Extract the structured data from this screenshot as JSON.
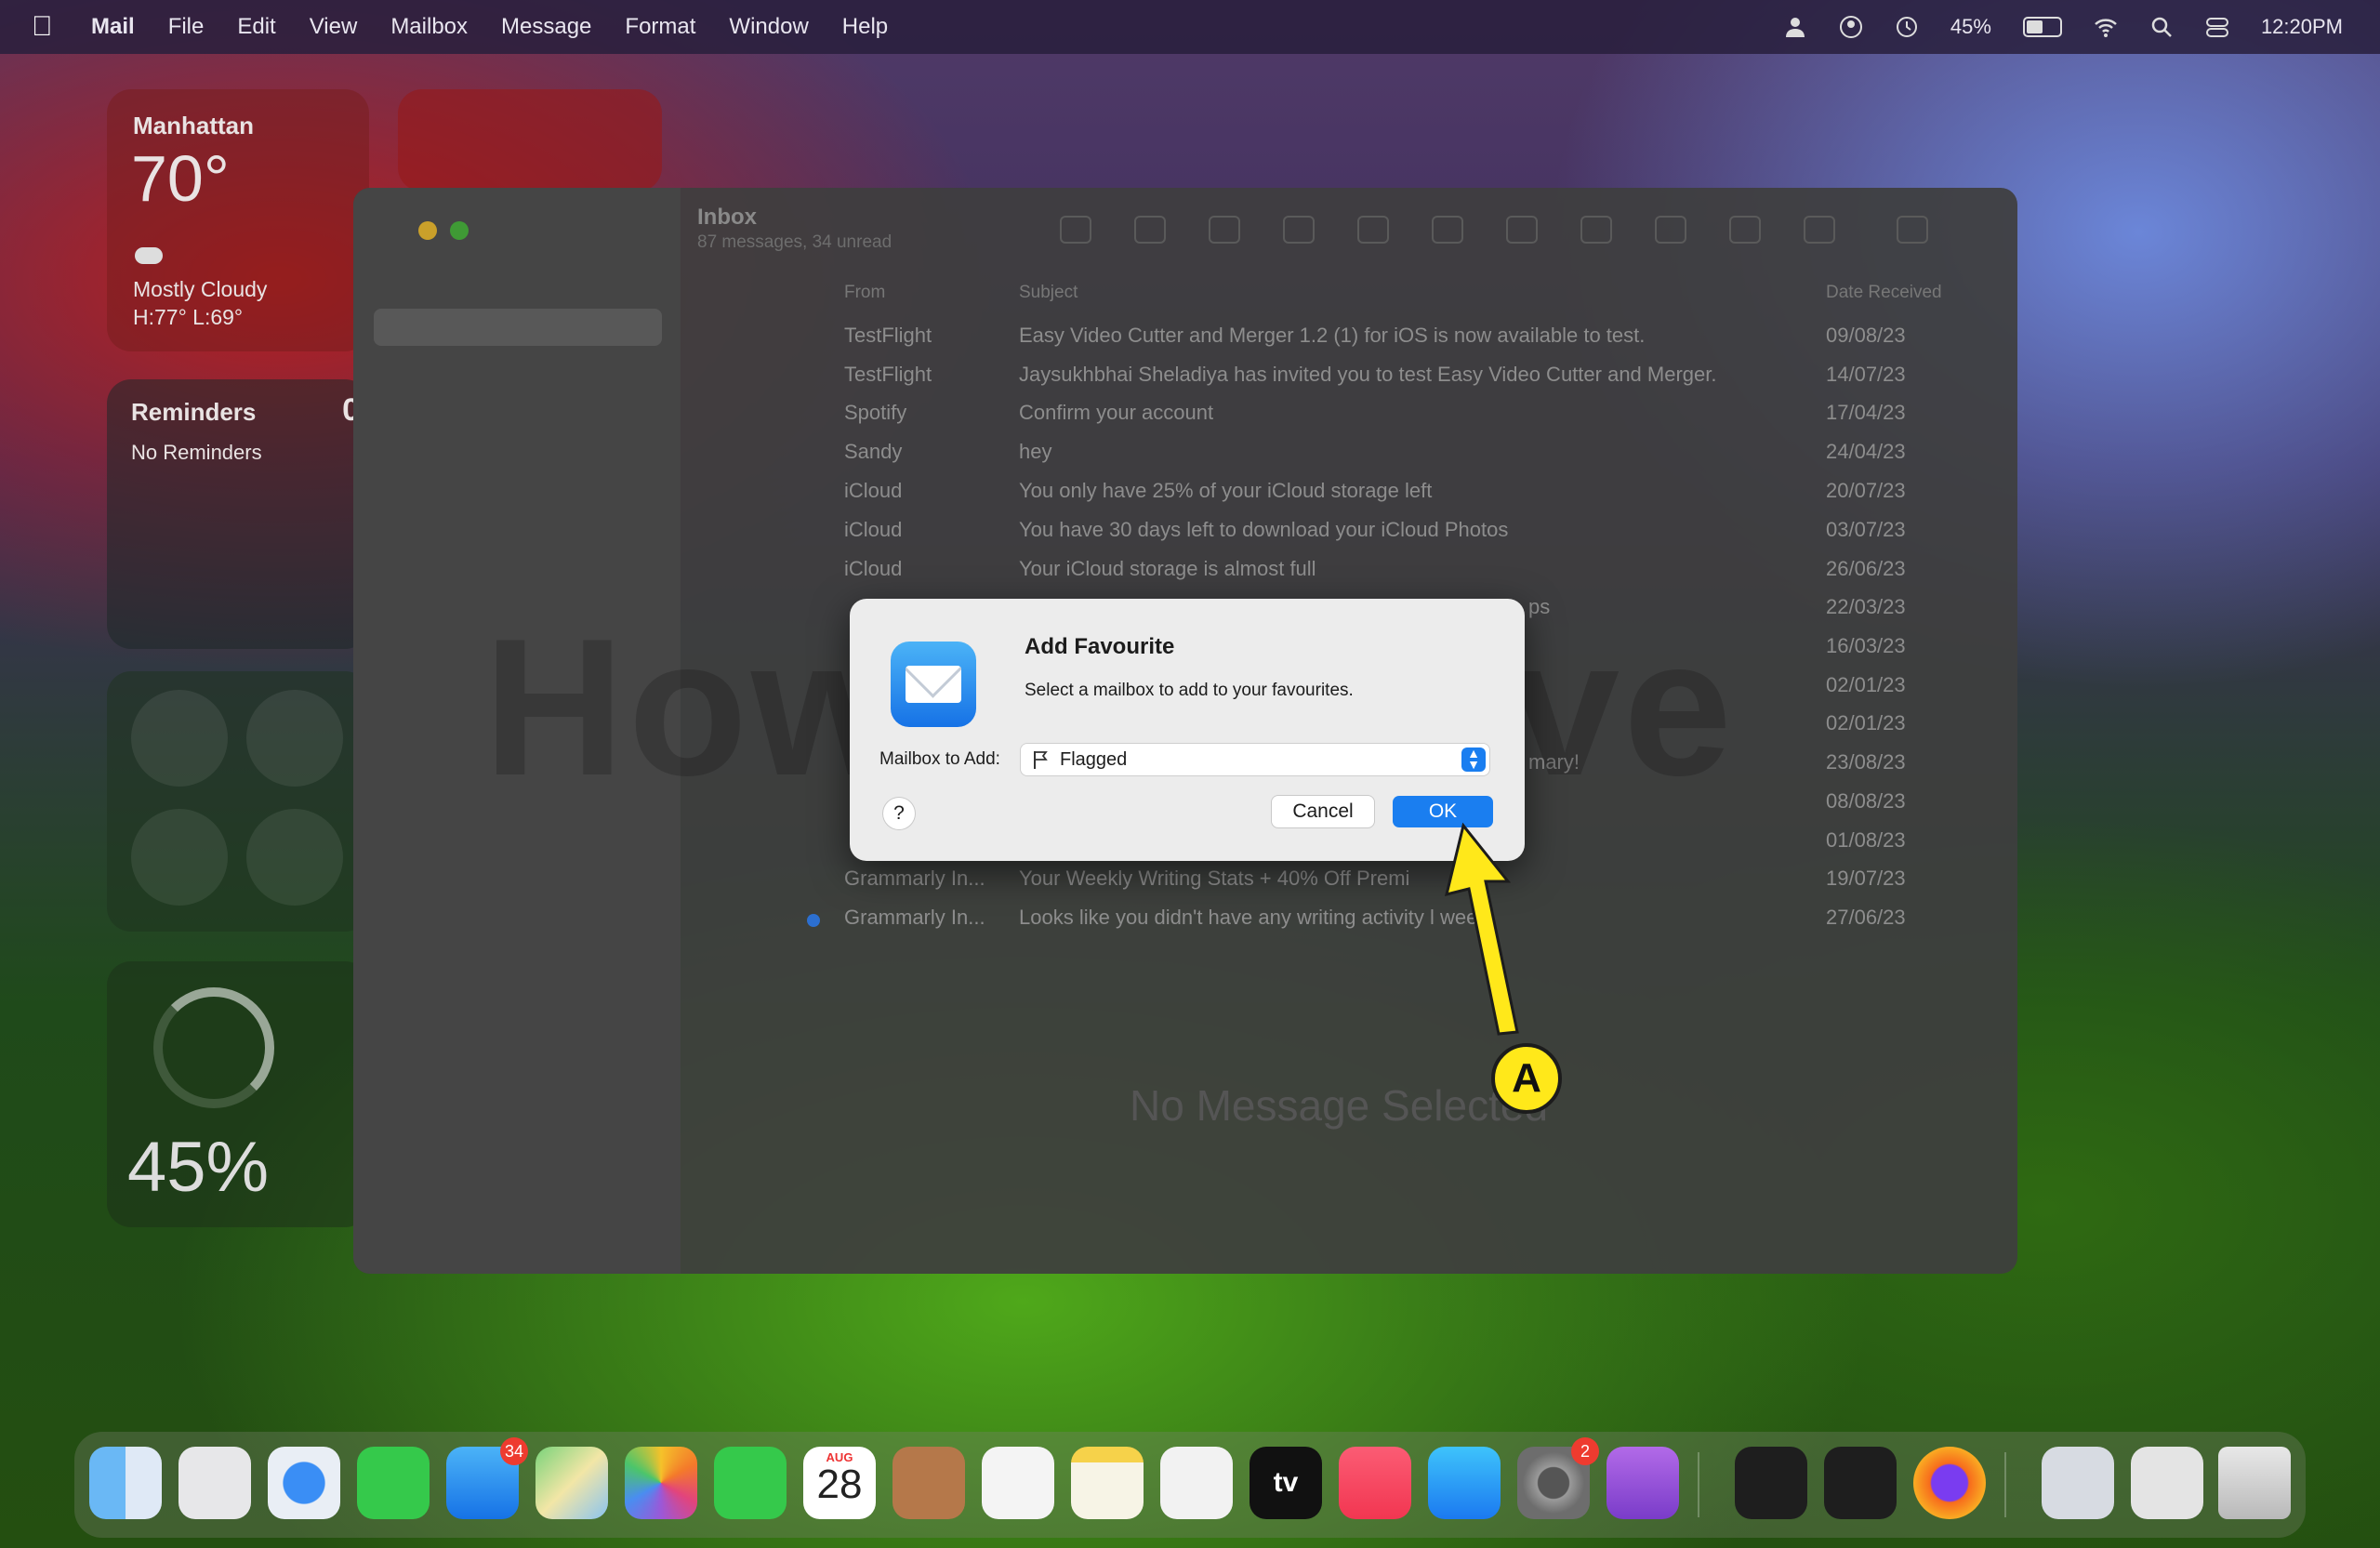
{
  "menubar": {
    "items": [
      "Mail",
      "File",
      "Edit",
      "View",
      "Mailbox",
      "Message",
      "Format",
      "Window",
      "Help"
    ],
    "battery_pct": "45%",
    "time": "12:20PM"
  },
  "widgets": {
    "weather": {
      "city": "Manhattan",
      "temp": "70°",
      "condition": "Mostly Cloudy",
      "high_low": "H:77° L:69°"
    },
    "reminders": {
      "title": "Reminders",
      "count": "0",
      "empty": "No Reminders"
    },
    "battery": {
      "percent": "45%"
    }
  },
  "mail": {
    "inbox_title": "Inbox",
    "inbox_sub": "87 messages, 34 unread",
    "columns": {
      "from": "From",
      "subject": "Subject",
      "date": "Date Received"
    },
    "rows": [
      {
        "from": "TestFlight",
        "subject": "Easy Video Cutter and Merger 1.2 (1) for iOS is now available to test.",
        "date": "09/08/23"
      },
      {
        "from": "TestFlight",
        "subject": "Jaysukhbhai Sheladiya has invited you to test Easy Video Cutter and Merger.",
        "date": "14/07/23"
      },
      {
        "from": "Spotify",
        "subject": "Confirm your account",
        "date": "17/04/23"
      },
      {
        "from": "Sandy",
        "subject": "hey",
        "date": "24/04/23"
      },
      {
        "from": "iCloud",
        "subject": "You only have 25% of your iCloud storage left",
        "date": "20/07/23"
      },
      {
        "from": "iCloud",
        "subject": "You have 30 days left to download your iCloud Photos",
        "date": "03/07/23"
      },
      {
        "from": "iCloud",
        "subject": "Your iCloud storage is almost full",
        "date": "26/06/23"
      },
      {
        "from": "",
        "subject": "ps",
        "date": "22/03/23"
      },
      {
        "from": "",
        "subject": "",
        "date": "16/03/23"
      },
      {
        "from": "",
        "subject": "",
        "date": "02/01/23"
      },
      {
        "from": "",
        "subject": "",
        "date": "02/01/23"
      },
      {
        "from": "",
        "subject": "mary!",
        "date": "23/08/23"
      },
      {
        "from": "",
        "subject": "",
        "date": "08/08/23"
      },
      {
        "from": "",
        "subject": "",
        "date": "01/08/23"
      },
      {
        "from": "Grammarly In...",
        "subject": "Your Weekly Writing Stats + 40% Off Premi",
        "date": "19/07/23"
      },
      {
        "from": "Grammarly In...",
        "subject": "Looks like you didn't have any writing activity l week.",
        "date": "27/06/23"
      }
    ],
    "no_message": "No Message Selected",
    "watermark": "HowToiSolve"
  },
  "dialog": {
    "title": "Add Favourite",
    "message": "Select a mailbox to add to your favourites.",
    "mailbox_label": "Mailbox to Add:",
    "selected_mailbox": "Flagged",
    "help_label": "?",
    "cancel_label": "Cancel",
    "ok_label": "OK",
    "accent_color": "#1a7ef0"
  },
  "annotation": {
    "label": "A"
  },
  "dock": {
    "mail_badge": "34",
    "settings_badge": "2",
    "calendar_month": "AUG",
    "calendar_day": "28",
    "tv_label": "tv"
  }
}
